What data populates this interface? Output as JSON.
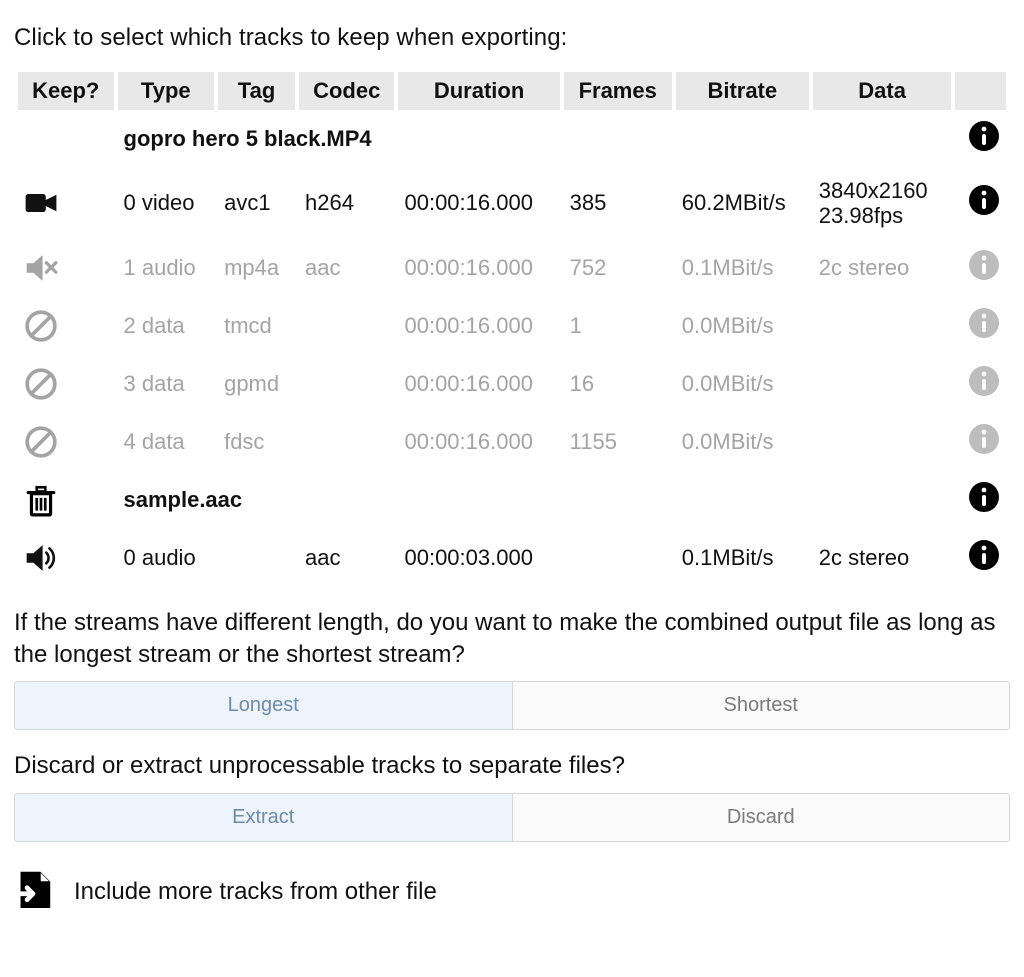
{
  "instruction": "Click to select which tracks to keep when exporting:",
  "columns": {
    "keep": "Keep?",
    "type": "Type",
    "tag": "Tag",
    "codec": "Codec",
    "duration": "Duration",
    "frames": "Frames",
    "bitrate": "Bitrate",
    "data": "Data"
  },
  "files": [
    {
      "name": "gopro hero 5 black.MP4",
      "icon": "trash-disabled",
      "tracks": [
        {
          "keep_icon": "video-on",
          "muted": false,
          "idx": "0",
          "type": "video",
          "tag": "avc1",
          "codec": "h264",
          "duration": "00:00:16.000",
          "frames": "385",
          "bitrate": "60.2MBit/s",
          "data_line1": "3840x2160",
          "data_line2": "23.98fps"
        },
        {
          "keep_icon": "audio-mute",
          "muted": true,
          "idx": "1",
          "type": "audio",
          "tag": "mp4a",
          "codec": "aac",
          "duration": "00:00:16.000",
          "frames": "752",
          "bitrate": "0.1MBit/s",
          "data_line1": "2c stereo",
          "data_line2": ""
        },
        {
          "keep_icon": "ban",
          "muted": true,
          "idx": "2",
          "type": "data",
          "tag": "tmcd",
          "codec": "",
          "duration": "00:00:16.000",
          "frames": "1",
          "bitrate": "0.0MBit/s",
          "data_line1": "",
          "data_line2": ""
        },
        {
          "keep_icon": "ban",
          "muted": true,
          "idx": "3",
          "type": "data",
          "tag": "gpmd",
          "codec": "",
          "duration": "00:00:16.000",
          "frames": "16",
          "bitrate": "0.0MBit/s",
          "data_line1": "",
          "data_line2": ""
        },
        {
          "keep_icon": "ban",
          "muted": true,
          "idx": "4",
          "type": "data",
          "tag": "fdsc",
          "codec": "",
          "duration": "00:00:16.000",
          "frames": "1155",
          "bitrate": "0.0MBit/s",
          "data_line1": "",
          "data_line2": ""
        }
      ]
    },
    {
      "name": "sample.aac",
      "icon": "trash",
      "tracks": [
        {
          "keep_icon": "audio-on",
          "muted": false,
          "idx": "0",
          "type": "audio",
          "tag": "",
          "codec": "aac",
          "duration": "00:00:03.000",
          "frames": "",
          "bitrate": "0.1MBit/s",
          "data_line1": "2c stereo",
          "data_line2": ""
        }
      ]
    }
  ],
  "length_question": "If the streams have different length, do you want to make the combined output file as long as the longest stream or the shortest stream?",
  "length_options": {
    "longest": "Longest",
    "shortest": "Shortest",
    "selected": "longest"
  },
  "unprocessable_question": "Discard or extract unprocessable tracks to separate files?",
  "unprocessable_options": {
    "extract": "Extract",
    "discard": "Discard",
    "selected": "extract"
  },
  "include_more": "Include more tracks from other file"
}
